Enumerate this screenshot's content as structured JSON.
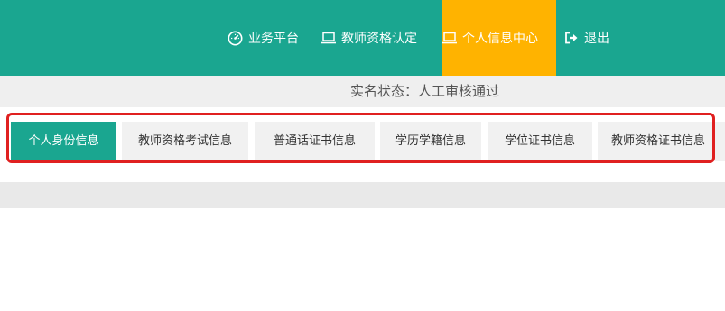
{
  "nav": {
    "items": [
      {
        "label": "业务平台",
        "icon": "dashboard-icon",
        "active": false
      },
      {
        "label": "教师资格认定",
        "icon": "monitor-icon",
        "active": false
      },
      {
        "label": "个人信息中心",
        "icon": "monitor-icon",
        "active": true
      },
      {
        "label": "退出",
        "icon": "logout-icon",
        "active": false
      }
    ]
  },
  "status": {
    "text": "实名状态：人工审核通过"
  },
  "tabs": [
    {
      "label": "个人身份信息",
      "active": true
    },
    {
      "label": "教师资格考试信息",
      "active": false
    },
    {
      "label": "普通话证书信息",
      "active": false
    },
    {
      "label": "学历学籍信息",
      "active": false
    },
    {
      "label": "学位证书信息",
      "active": false
    },
    {
      "label": "教师资格证书信息",
      "active": false
    }
  ],
  "colors": {
    "header": "#1aa690",
    "active_nav": "#ffb300",
    "highlight_frame": "#e02020"
  }
}
